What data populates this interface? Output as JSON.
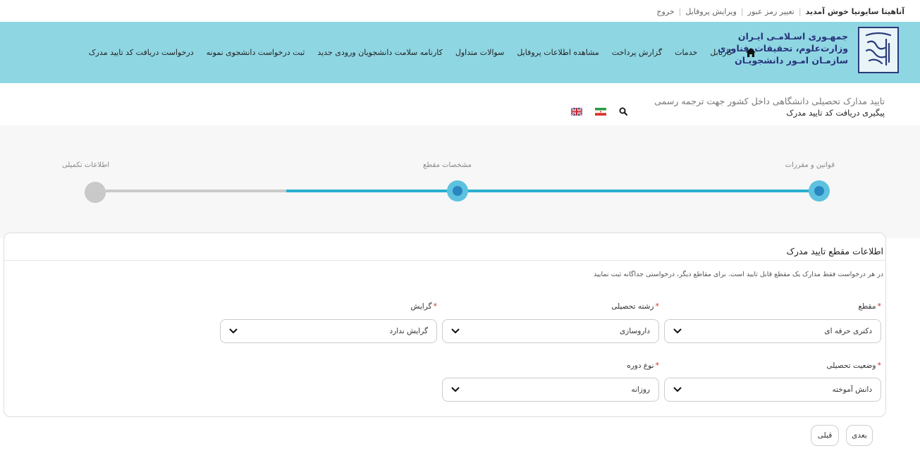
{
  "user_bar": {
    "welcome": "آناهیتا سایونیا خوش آمدید",
    "change_password": "تغییر رمز عبور",
    "edit_profile": "ویرایش پروفایل",
    "logout": "خروج"
  },
  "brand": {
    "line1": "جمهـوری اسـلامـی ایـران",
    "line2": "وزارت‌علوم، تحقیقات‌وفناوری",
    "line3": "سازمـان امـور دانشجویـان"
  },
  "nav": {
    "items": [
      "کارتابل",
      "خدمات",
      "گزارش پرداخت",
      "مشاهده اطلاعات پروفایل",
      "سوالات متداول",
      "کارنامه سلامت دانشجویان ورودی جدید",
      "ثبت درخواست دانشجوی نمونه",
      "درخواست دریافت کد تایید مدرک"
    ]
  },
  "page": {
    "title": "تایید مدارک تحصیلی دانشگاهی داخل کشور جهت ترجمه رسمی",
    "subtitle": "پیگیری دریافت کد تایید مدرک"
  },
  "stepper": {
    "steps": [
      {
        "label": "قوانین و مقررات",
        "state": "active"
      },
      {
        "label": "مشخصات مقطع",
        "state": "active"
      },
      {
        "label": "اطلاعات تکمیلی",
        "state": "inactive"
      }
    ],
    "progress_color": "#2ab0cf",
    "inactive_color": "#c9c9c9"
  },
  "form": {
    "title": "اطلاعات مقطع تایید مدرک",
    "note": "در هر درخواست فقط مدارک یک مقطع قابل تایید است. برای مقاطع دیگر، درخواستی جداگانه ثبت نمایید",
    "fields": {
      "degree": {
        "label": "مقطع",
        "value": "دکتری حرفه ای"
      },
      "major": {
        "label": "رشته تحصیلی",
        "value": "داروسازی"
      },
      "orientation": {
        "label": "گرایش",
        "value": "گرایش ندارد"
      },
      "status": {
        "label": "وضعیت تحصیلی",
        "value": "دانش آموخته"
      },
      "course_type": {
        "label": "نوع دوره",
        "value": "روزانه"
      }
    },
    "next_button": "بعدی",
    "prev_button": "قبلی"
  },
  "colors": {
    "header_bg": "#8fd6e3",
    "brand_text": "#27337a",
    "required_mark": "#d0302a"
  }
}
